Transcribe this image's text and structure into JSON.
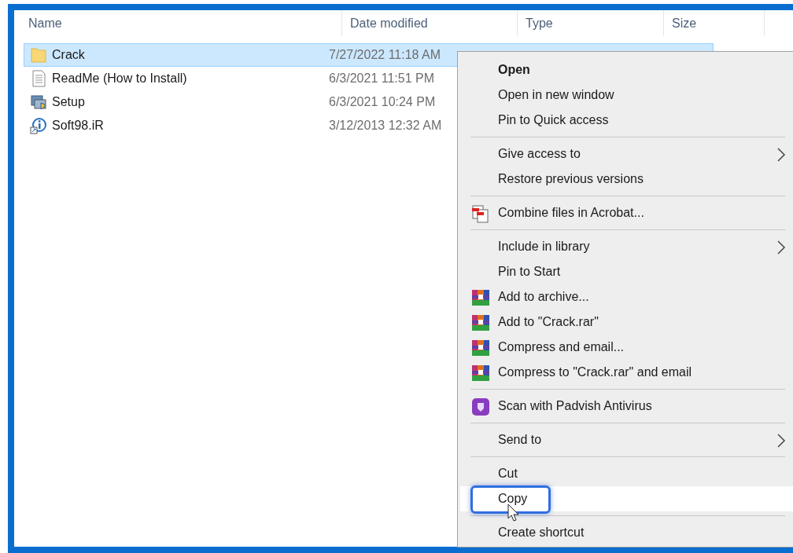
{
  "columns": [
    {
      "label": "Name"
    },
    {
      "label": "Date modified"
    },
    {
      "label": "Type"
    },
    {
      "label": "Size"
    }
  ],
  "files": [
    {
      "name": "Crack",
      "date": "7/27/2022 11:18 AM",
      "kind": "folder",
      "selected": true
    },
    {
      "name": "ReadMe (How to Install)",
      "date": "6/3/2021 11:51 PM",
      "kind": "text",
      "selected": false
    },
    {
      "name": "Setup",
      "date": "6/3/2021 10:24 PM",
      "kind": "setup",
      "selected": false
    },
    {
      "name": "Soft98.iR",
      "date": "3/12/2013 12:32 AM",
      "kind": "shortcut",
      "selected": false
    }
  ],
  "context_menu": {
    "items": [
      {
        "kind": "item",
        "label": "Open",
        "default": true,
        "submenu": false,
        "selected": false
      },
      {
        "kind": "item",
        "label": "Open in new window",
        "default": false,
        "submenu": false,
        "selected": false
      },
      {
        "kind": "item",
        "label": "Pin to Quick access",
        "default": false,
        "submenu": false,
        "selected": false
      },
      {
        "kind": "separator"
      },
      {
        "kind": "item",
        "label": "Give access to",
        "default": false,
        "submenu": true,
        "selected": false
      },
      {
        "kind": "item",
        "label": "Restore previous versions",
        "default": false,
        "submenu": false,
        "selected": false
      },
      {
        "kind": "separator"
      },
      {
        "kind": "acrobat",
        "label": "Combine files in Acrobat...",
        "default": false,
        "submenu": false,
        "selected": false
      },
      {
        "kind": "separator"
      },
      {
        "kind": "item",
        "label": "Include in library",
        "default": false,
        "submenu": true,
        "selected": false
      },
      {
        "kind": "item",
        "label": "Pin to Start",
        "default": false,
        "submenu": false,
        "selected": false
      },
      {
        "kind": "archive",
        "label": "Add to archive...",
        "default": false,
        "submenu": false,
        "selected": false
      },
      {
        "kind": "archive",
        "label": "Add to \"Crack.rar\"",
        "default": false,
        "submenu": false,
        "selected": false
      },
      {
        "kind": "archive",
        "label": "Compress and email...",
        "default": false,
        "submenu": false,
        "selected": false
      },
      {
        "kind": "archive",
        "label": "Compress to \"Crack.rar\" and email",
        "default": false,
        "submenu": false,
        "selected": false
      },
      {
        "kind": "separator"
      },
      {
        "kind": "antivirus",
        "label": "Scan with Padvish Antivirus",
        "default": false,
        "submenu": false,
        "selected": false
      },
      {
        "kind": "separator"
      },
      {
        "kind": "item",
        "label": "Send to",
        "default": false,
        "submenu": true,
        "selected": false
      },
      {
        "kind": "separator"
      },
      {
        "kind": "item",
        "label": "Cut",
        "default": false,
        "submenu": false,
        "selected": false
      },
      {
        "kind": "item",
        "label": "Copy",
        "default": false,
        "submenu": false,
        "selected": true
      },
      {
        "kind": "separator"
      },
      {
        "kind": "item",
        "label": "Create shortcut",
        "default": false,
        "submenu": false,
        "selected": false
      }
    ]
  }
}
